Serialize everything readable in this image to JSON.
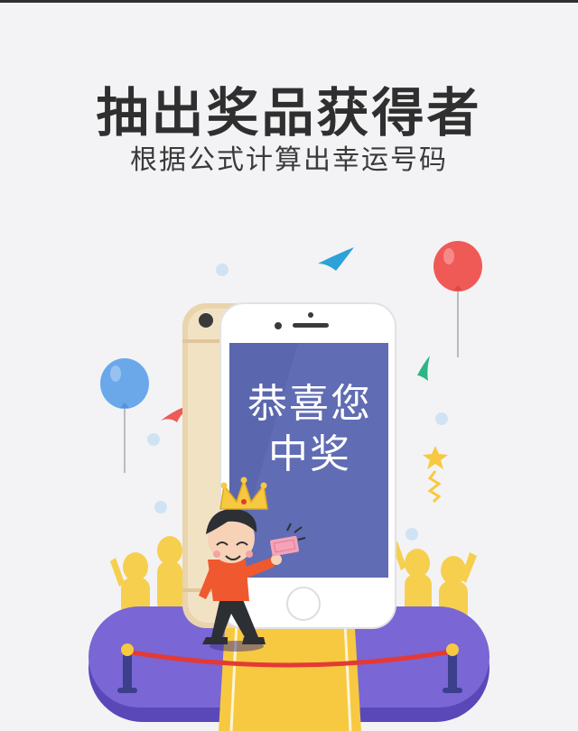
{
  "header": {
    "title": "抽出奖品获得者",
    "subtitle": "根据公式计算出幸运号码"
  },
  "phone_screen": {
    "line1": "恭喜您",
    "line2": "中奖"
  },
  "illustration": {
    "icons": [
      "balloon-icon",
      "star-icon",
      "crown-icon",
      "confetti-icon",
      "ticket-icon",
      "rope-barrier-icon"
    ],
    "colors": {
      "background": "#f3f3f5",
      "stage": "#7a66d4",
      "stage_shadow": "#5a47b8",
      "carpet": "#f7c940",
      "screen": "#5560a8",
      "balloon_red": "#f05a56",
      "balloon_blue": "#6aa8ea",
      "crowd": "#f6cf4f",
      "shirt": "#f0582f"
    }
  }
}
